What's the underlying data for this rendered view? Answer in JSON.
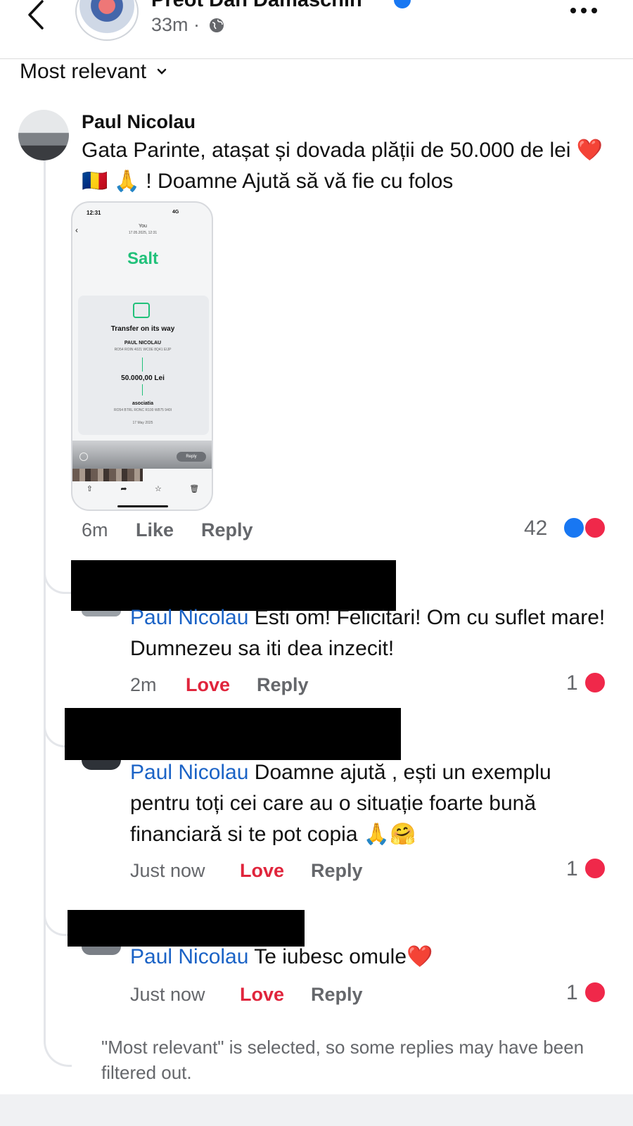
{
  "header": {
    "title": "Preot Dan Damaschin",
    "time": "33m",
    "separator": "·"
  },
  "sort": {
    "label": "Most relevant"
  },
  "main_comment": {
    "author": "Paul Nicolau",
    "text": "Gata Parinte, atașat și dovada plății de 50.000 de lei ❤️ 🇷🇴 🙏 ! Doamne Ajută să vă fie cu folos",
    "time": "6m",
    "like_label": "Like",
    "reply_label": "Reply",
    "reaction_count": "42",
    "attachment": {
      "status_time": "12:31",
      "status_right": "4G",
      "top_title": "You",
      "top_date": "17.05.2025, 12:31",
      "brand": "Salt",
      "heading": "Transfer on its way",
      "sender": "PAUL NICOLAU",
      "sender_iban": "RO54 ROIN 4021 WC0E 8Q41 EIJP",
      "amount": "50.000,00 Lei",
      "recipient": "asociatia",
      "recipient_iban": "RO54 BTRL RONC R100 W875 940I",
      "date": "17 May 2025",
      "reply_chip": "Reply"
    }
  },
  "replies": [
    {
      "mention": "Paul Nicolau",
      "text": " Esti om! Felicitari! Om cu suflet mare! Dumnezeu sa iti dea inzecit!",
      "time": "2m",
      "love_label": "Love",
      "reply_label": "Reply",
      "reaction_count": "1"
    },
    {
      "mention": "Paul Nicolau",
      "text": " Doamne ajută , ești un exemplu pentru toți cei care au o situație foarte bună financiară si te pot copia 🙏🤗",
      "time": "Just now",
      "love_label": "Love",
      "reply_label": "Reply",
      "reaction_count": "1"
    },
    {
      "mention": "Paul Nicolau",
      "text": " Te iubesc omule❤️",
      "time": "Just now",
      "love_label": "Love",
      "reply_label": "Reply",
      "reaction_count": "1"
    }
  ],
  "footer_note": "\"Most relevant\" is selected, so some replies may have been filtered out.",
  "colors": {
    "mention": "#1b63c6",
    "love": "#e0253c",
    "like_blue": "#1877f2",
    "salt_green": "#21c17a"
  },
  "icons": {
    "back": "chevron-left-icon",
    "verified": "verified-badge-icon",
    "privacy": "globe-icon",
    "more": "more-horizontal-icon",
    "sort": "chevron-down-icon"
  }
}
